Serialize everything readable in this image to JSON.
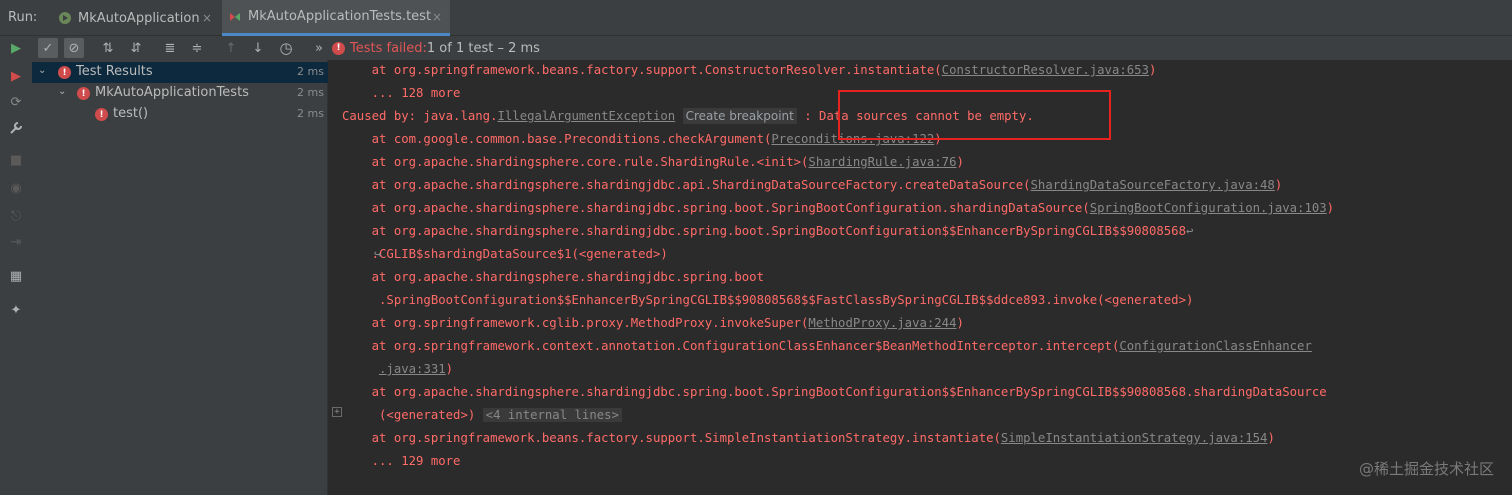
{
  "run_panel": {
    "label": "Run:",
    "tabs": [
      {
        "label": "MkAutoApplication",
        "icon": "spring-run-icon",
        "active": false
      },
      {
        "label": "MkAutoApplicationTests.test",
        "icon": "test-config-icon",
        "active": true
      }
    ],
    "close_glyph": "×"
  },
  "toolbar": {
    "buttons": [
      {
        "name": "rerun-button",
        "icon": "play-icon",
        "glyph": "▶"
      },
      {
        "name": "show-passed-button",
        "icon": "check-icon",
        "glyph": "✓"
      },
      {
        "name": "show-ignored-button",
        "icon": "ignore-icon",
        "glyph": "⊘"
      },
      {
        "name": "sort-alpha-button",
        "icon": "sort-alpha-icon",
        "glyph": "⇅"
      },
      {
        "name": "sort-duration-button",
        "icon": "sort-duration-icon",
        "glyph": "⇵"
      },
      {
        "name": "expand-all-button",
        "icon": "expand-all-icon",
        "glyph": "≣"
      },
      {
        "name": "collapse-all-button",
        "icon": "collapse-all-icon",
        "glyph": "≑"
      },
      {
        "name": "prev-failed-button",
        "icon": "arrow-up-icon",
        "glyph": "↑"
      },
      {
        "name": "next-failed-button",
        "icon": "arrow-down-icon",
        "glyph": "↓"
      },
      {
        "name": "history-button",
        "icon": "clock-icon",
        "glyph": "◷"
      },
      {
        "name": "more-button",
        "icon": "more-icon",
        "glyph": "»"
      }
    ],
    "status_failed": "Tests failed:",
    "status_detail": " 1 of 1 test – 2 ms"
  },
  "left_strip": {
    "icons": [
      {
        "name": "rerun-failed-icon",
        "glyph": "▶"
      },
      {
        "name": "toggle-auto-test-icon",
        "glyph": "⟳"
      },
      {
        "name": "wrench-icon",
        "glyph": "🔧"
      },
      {
        "name": "stop-icon",
        "glyph": "■"
      },
      {
        "name": "camera-icon",
        "glyph": "◉"
      },
      {
        "name": "export-icon",
        "glyph": "⎋"
      },
      {
        "name": "import-icon",
        "glyph": "⇥"
      },
      {
        "name": "layout-icon",
        "glyph": "▦"
      },
      {
        "name": "pin-icon",
        "glyph": "✦"
      }
    ]
  },
  "tree": {
    "rows": [
      {
        "label": "Test Results",
        "time": "2 ms",
        "level": 0
      },
      {
        "label": "MkAutoApplicationTests",
        "time": "2 ms",
        "level": 1
      },
      {
        "label": "test()",
        "time": "2 ms",
        "level": 2
      }
    ]
  },
  "console": {
    "l1_pre": "    at org.springframework.beans.factory.support.ConstructorResolver.instantiate(",
    "l1_link": "ConstructorResolver.java:653",
    "l1_post": ")",
    "l2": "    ... 128 more",
    "l3_pre": "Caused by: java.lang.",
    "l3_link": "IllegalArgumentException",
    "l3_hint": "Create breakpoint",
    "l3_post": " : Data sources cannot be empty.",
    "l4_pre": "    at com.google.common.base.Preconditions.checkArgument(",
    "l4_link": "Preconditions.java:122",
    "l4_post": ")",
    "l5_pre": "    at org.apache.shardingsphere.core.rule.ShardingRule.<init>(",
    "l5_link": "ShardingRule.java:76",
    "l5_post": ")",
    "l6_pre": "    at org.apache.shardingsphere.shardingjdbc.api.ShardingDataSourceFactory.createDataSource(",
    "l6_link": "ShardingDataSourceFactory.java:48",
    "l6_post": ")",
    "l7_pre": "    at org.apache.shardingsphere.shardingjdbc.spring.boot.SpringBootConfiguration.shardingDataSource(",
    "l7_link": "SpringBootConfiguration.java:103",
    "l7_post": ")",
    "l8": "    at org.apache.shardingsphere.shardingjdbc.spring.boot.SpringBootConfiguration$$EnhancerBySpringCGLIB$$90808568",
    "l9": "    .CGLIB$shardingDataSource$1(<generated>)",
    "l10": "    at org.apache.shardingsphere.shardingjdbc.spring.boot",
    "l11": "     .SpringBootConfiguration$$EnhancerBySpringCGLIB$$90808568$$FastClassBySpringCGLIB$$ddce893.invoke(<generated>)",
    "l12_pre": "    at org.springframework.cglib.proxy.MethodProxy.invokeSuper(",
    "l12_link": "MethodProxy.java:244",
    "l12_post": ")",
    "l13_pre": "    at org.springframework.context.annotation.ConfigurationClassEnhancer$BeanMethodInterceptor.intercept(",
    "l13_link": "ConfigurationClassEnhancer",
    "l14_pre": "     ",
    "l14_link": ".java:331",
    "l14_post": ")",
    "l15": "    at org.apache.shardingsphere.shardingjdbc.spring.boot.SpringBootConfiguration$$EnhancerBySpringCGLIB$$90808568.shardingDataSource",
    "l16_pre": "     (<generated>) ",
    "l16_fold": "<4 internal lines>",
    "l17_pre": "    at org.springframework.beans.factory.support.SimpleInstantiationStrategy.instantiate(",
    "l17_link": "SimpleInstantiationStrategy.java:154",
    "l17_post": ")",
    "l18": "    ... 129 more"
  },
  "watermark": "@稀土掘金技术社区",
  "colors": {
    "error_text": "#ff6b68",
    "highlight_box": "#e8221f",
    "background": "#2b2b2b",
    "panel": "#3c3f41"
  }
}
